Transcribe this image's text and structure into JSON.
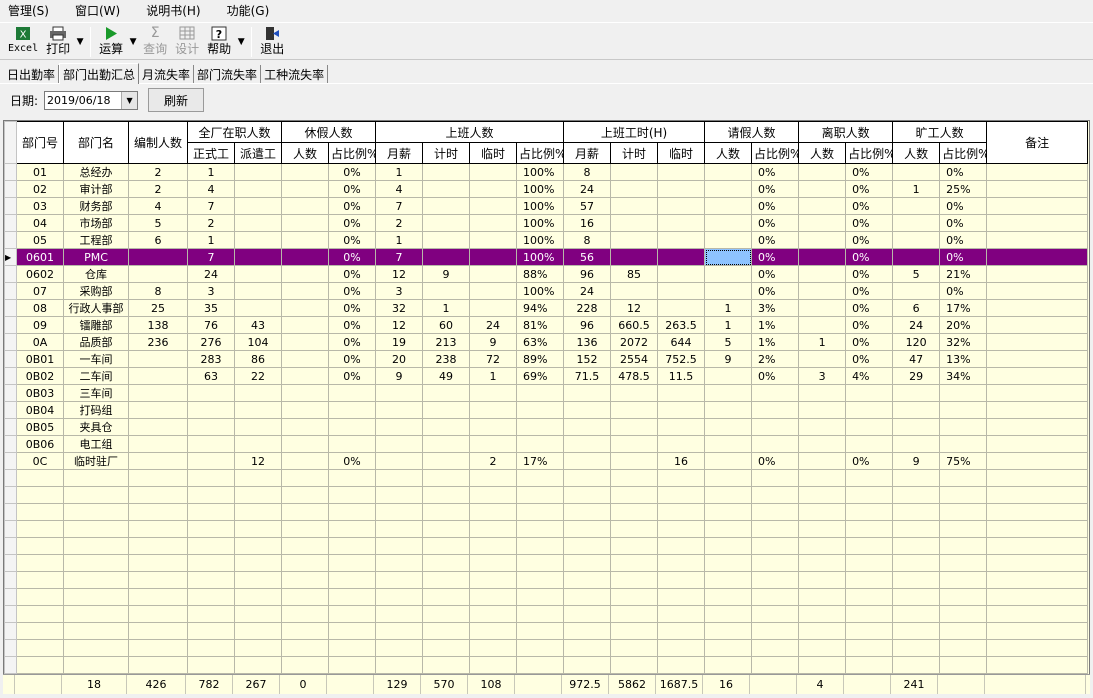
{
  "menu": [
    "管理(S)",
    "窗口(W)",
    "说明书(H)",
    "功能(G)"
  ],
  "toolbar": {
    "excel": "Excel",
    "print": "打印",
    "run": "运算",
    "query": "查询",
    "design": "设计",
    "help": "帮助",
    "exit": "退出"
  },
  "tabs": [
    "日出勤率",
    "部门出勤汇总",
    "月流失率",
    "部门流失率",
    "工种流失率"
  ],
  "filter": {
    "date_label": "日期:",
    "date_value": "2019/06/18",
    "refresh": "刷新"
  },
  "columns": {
    "dept_no": "部门号",
    "dept_name": "部门名",
    "quota": "编制人数",
    "onjob": "全厂在职人数",
    "onjob_formal": "正式工",
    "onjob_dispatch": "派遣工",
    "leave": "休假人数",
    "people": "人数",
    "ratio": "占比例%",
    "work": "上班人数",
    "monthly": "月薪",
    "piece": "计时",
    "temp": "临时",
    "hours": "上班工时(H)",
    "askleave": "请假人数",
    "resign": "离职人数",
    "absent": "旷工人数",
    "remark": "备注"
  },
  "rows": [
    [
      "01",
      "总经办",
      "2",
      "1",
      "",
      "",
      "0%",
      "1",
      "",
      "",
      "100%",
      "8",
      "",
      "",
      "",
      "0%",
      "",
      "0%",
      "",
      "0%",
      ""
    ],
    [
      "02",
      "审计部",
      "2",
      "4",
      "",
      "",
      "0%",
      "4",
      "",
      "",
      "100%",
      "24",
      "",
      "",
      "",
      "0%",
      "",
      "0%",
      "1",
      "25%",
      ""
    ],
    [
      "03",
      "财务部",
      "4",
      "7",
      "",
      "",
      "0%",
      "7",
      "",
      "",
      "100%",
      "57",
      "",
      "",
      "",
      "0%",
      "",
      "0%",
      "",
      "0%",
      ""
    ],
    [
      "04",
      "市场部",
      "5",
      "2",
      "",
      "",
      "0%",
      "2",
      "",
      "",
      "100%",
      "16",
      "",
      "",
      "",
      "0%",
      "",
      "0%",
      "",
      "0%",
      ""
    ],
    [
      "05",
      "工程部",
      "6",
      "1",
      "",
      "",
      "0%",
      "1",
      "",
      "",
      "100%",
      "8",
      "",
      "",
      "",
      "0%",
      "",
      "0%",
      "",
      "0%",
      ""
    ],
    [
      "0601",
      "PMC",
      "",
      "7",
      "",
      "",
      "0%",
      "7",
      "",
      "",
      "100%",
      "56",
      "",
      "",
      "",
      "0%",
      "",
      "0%",
      "",
      "0%",
      ""
    ],
    [
      "0602",
      "仓库",
      "",
      "24",
      "",
      "",
      "0%",
      "12",
      "9",
      "",
      "88%",
      "96",
      "85",
      "",
      "",
      "0%",
      "",
      "0%",
      "5",
      "21%",
      ""
    ],
    [
      "07",
      "采购部",
      "8",
      "3",
      "",
      "",
      "0%",
      "3",
      "",
      "",
      "100%",
      "24",
      "",
      "",
      "",
      "0%",
      "",
      "0%",
      "",
      "0%",
      ""
    ],
    [
      "08",
      "行政人事部",
      "25",
      "35",
      "",
      "",
      "0%",
      "32",
      "1",
      "",
      "94%",
      "228",
      "12",
      "",
      "1",
      "3%",
      "",
      "0%",
      "6",
      "17%",
      ""
    ],
    [
      "09",
      "镭雕部",
      "138",
      "76",
      "43",
      "",
      "0%",
      "12",
      "60",
      "24",
      "81%",
      "96",
      "660.5",
      "263.5",
      "1",
      "1%",
      "",
      "0%",
      "24",
      "20%",
      ""
    ],
    [
      "0A",
      "品质部",
      "236",
      "276",
      "104",
      "",
      "0%",
      "19",
      "213",
      "9",
      "63%",
      "136",
      "2072",
      "644",
      "5",
      "1%",
      "1",
      "0%",
      "120",
      "32%",
      ""
    ],
    [
      "0B01",
      "一车间",
      "",
      "283",
      "86",
      "",
      "0%",
      "20",
      "238",
      "72",
      "89%",
      "152",
      "2554",
      "752.5",
      "9",
      "2%",
      "",
      "0%",
      "47",
      "13%",
      ""
    ],
    [
      "0B02",
      "二车间",
      "",
      "63",
      "22",
      "",
      "0%",
      "9",
      "49",
      "1",
      "69%",
      "71.5",
      "478.5",
      "11.5",
      "",
      "0%",
      "3",
      "4%",
      "29",
      "34%",
      ""
    ],
    [
      "0B03",
      "三车间",
      "",
      "",
      "",
      "",
      "",
      "",
      "",
      "",
      "",
      "",
      "",
      "",
      "",
      "",
      "",
      "",
      "",
      "",
      ""
    ],
    [
      "0B04",
      "打码组",
      "",
      "",
      "",
      "",
      "",
      "",
      "",
      "",
      "",
      "",
      "",
      "",
      "",
      "",
      "",
      "",
      "",
      "",
      ""
    ],
    [
      "0B05",
      "夹具仓",
      "",
      "",
      "",
      "",
      "",
      "",
      "",
      "",
      "",
      "",
      "",
      "",
      "",
      "",
      "",
      "",
      "",
      "",
      ""
    ],
    [
      "0B06",
      "电工组",
      "",
      "",
      "",
      "",
      "",
      "",
      "",
      "",
      "",
      "",
      "",
      "",
      "",
      "",
      "",
      "",
      "",
      "",
      ""
    ],
    [
      "0C",
      "临时驻厂",
      "",
      "",
      "12",
      "",
      "0%",
      "",
      "",
      "2",
      "17%",
      "",
      "",
      "16",
      "",
      "0%",
      "",
      "0%",
      "9",
      "75%",
      ""
    ]
  ],
  "selected_row": 5,
  "totals": [
    "",
    "18",
    "426",
    "782",
    "267",
    "0",
    "",
    "129",
    "570",
    "108",
    "",
    "972.5",
    "5862",
    "1687.5",
    "16",
    "",
    "4",
    "",
    "241",
    "",
    ""
  ]
}
